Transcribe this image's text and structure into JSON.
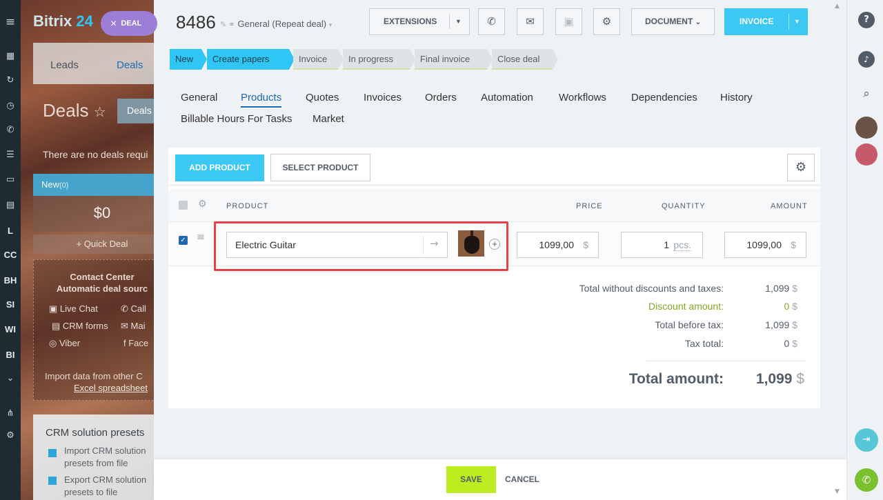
{
  "left_nav": {
    "items": [
      "≡",
      "▦",
      "↻",
      "◷",
      "✆",
      "☰",
      "▭",
      "▤",
      "L",
      "CC",
      "BH",
      "SI",
      "WI",
      "BI",
      "⌄",
      "⋔",
      "⚙"
    ]
  },
  "background_page": {
    "logo_text": "Bitrix",
    "logo_num": "24",
    "tabs": [
      "Leads",
      "Deals"
    ],
    "title": "Deals",
    "title_star": "☆",
    "deals_button": "Deals",
    "notice": "There are no deals requi",
    "stage": {
      "name": "New",
      "count": "(0)"
    },
    "sum": "$0",
    "quick_deal": "+ Quick Deal",
    "contact_center": {
      "title": "Contact Center",
      "subtitle": "Automatic deal sourc",
      "channels": [
        "Live Chat",
        "Call",
        "CRM forms",
        "Mai",
        "Viber",
        "Face"
      ],
      "import_text": "Import data from other C",
      "import_link": "Excel spreadsheet"
    },
    "presets": {
      "title": "CRM solution presets",
      "items": [
        "Import CRM solution presets from file",
        "Export CRM solution presets to file"
      ]
    }
  },
  "deal_chip": {
    "close": "×",
    "label": "DEAL"
  },
  "header": {
    "deal_id": "8486",
    "category": "General (Repeat deal)",
    "extensions_label": "EXTENSIONS",
    "document_label": "DOCUMENT",
    "invoice_label": "INVOICE"
  },
  "stages": [
    {
      "label": "New",
      "state": "done"
    },
    {
      "label": "Create papers",
      "state": "done"
    },
    {
      "label": "Invoice",
      "state": "todo"
    },
    {
      "label": "In progress",
      "state": "todo"
    },
    {
      "label": "Final invoice",
      "state": "todo"
    },
    {
      "label": "Close deal",
      "state": "todo"
    }
  ],
  "tabs": [
    {
      "label": "General",
      "active": false
    },
    {
      "label": "Products",
      "active": true
    },
    {
      "label": "Quotes",
      "active": false
    },
    {
      "label": "Invoices",
      "active": false
    },
    {
      "label": "Orders",
      "active": false
    },
    {
      "label": "Automation",
      "active": false
    },
    {
      "label": "Workflows",
      "active": false
    },
    {
      "label": "Dependencies",
      "active": false
    },
    {
      "label": "History",
      "active": false
    },
    {
      "label": "Billable Hours For Tasks",
      "active": false
    },
    {
      "label": "Market",
      "active": false
    }
  ],
  "products": {
    "add_button": "ADD PRODUCT",
    "select_button": "SELECT PRODUCT",
    "columns": {
      "product": "PRODUCT",
      "price": "PRICE",
      "quantity": "QUANTITY",
      "amount": "AMOUNT"
    },
    "rows": [
      {
        "checked": true,
        "name": "Electric Guitar",
        "price": "1099,00",
        "currency": "$",
        "quantity": "1",
        "unit": "pcs.",
        "amount": "1099,00"
      }
    ]
  },
  "totals": {
    "without_discounts_label": "Total without discounts and taxes:",
    "without_discounts_value": "1,099",
    "discount_label": "Discount amount:",
    "discount_value": "0",
    "before_tax_label": "Total before tax:",
    "before_tax_value": "1,099",
    "tax_label": "Tax total:",
    "tax_value": "0",
    "total_label": "Total amount:",
    "total_value": "1,099",
    "currency": "$"
  },
  "footer": {
    "save_label": "SAVE",
    "cancel_label": "CANCEL"
  },
  "colors": {
    "accent": "#3bc8f5",
    "save": "#bbed21",
    "highlight": "#e74048",
    "link": "#2067b0"
  }
}
